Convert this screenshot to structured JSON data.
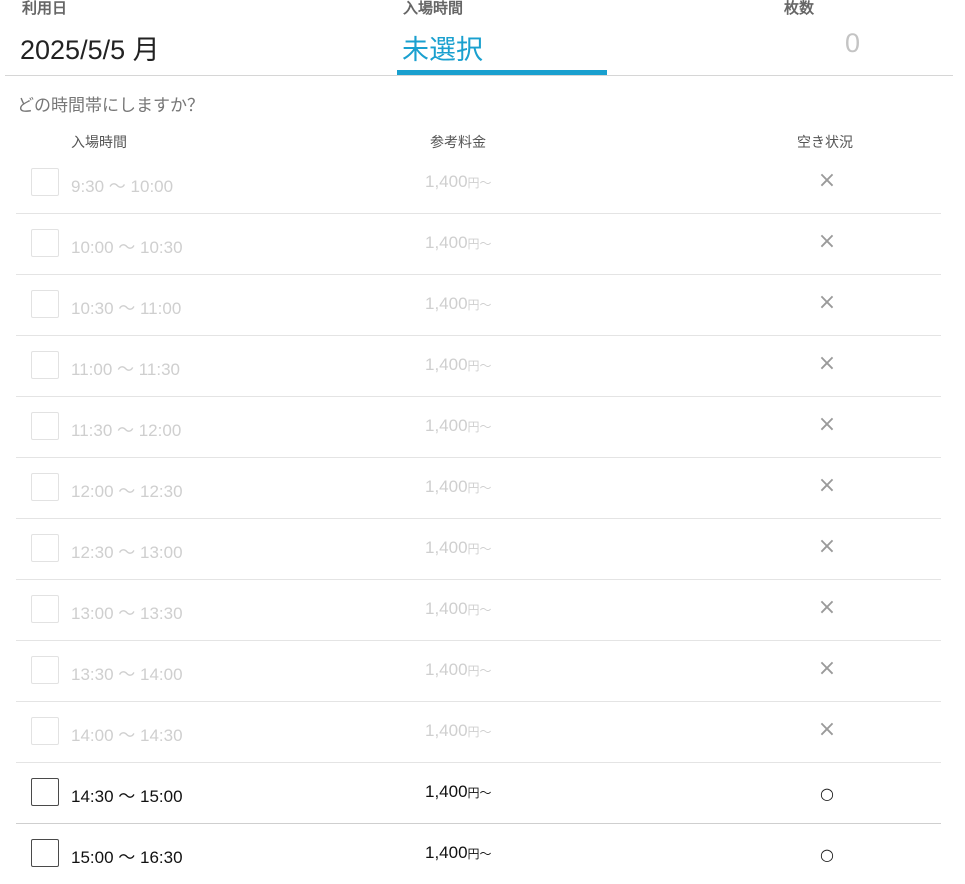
{
  "summary": {
    "date_label": "利用日",
    "date_value": "2025/5/5 月",
    "time_label": "入場時間",
    "time_value": "未選択",
    "count_label": "枚数",
    "count_value": "0"
  },
  "question": "どの時間帯にしますか？",
  "table": {
    "headers": {
      "time": "入場時間",
      "price": "参考料金",
      "status": "空き状況"
    },
    "rows": [
      {
        "time": "9:30 〜 10:00",
        "price": "1,400",
        "unit": "円〜",
        "status": "×",
        "available": false
      },
      {
        "time": "10:00 〜 10:30",
        "price": "1,400",
        "unit": "円〜",
        "status": "×",
        "available": false
      },
      {
        "time": "10:30 〜 11:00",
        "price": "1,400",
        "unit": "円〜",
        "status": "×",
        "available": false
      },
      {
        "time": "11:00 〜 11:30",
        "price": "1,400",
        "unit": "円〜",
        "status": "×",
        "available": false
      },
      {
        "time": "11:30 〜 12:00",
        "price": "1,400",
        "unit": "円〜",
        "status": "×",
        "available": false
      },
      {
        "time": "12:00 〜 12:30",
        "price": "1,400",
        "unit": "円〜",
        "status": "×",
        "available": false
      },
      {
        "time": "12:30 〜 13:00",
        "price": "1,400",
        "unit": "円〜",
        "status": "×",
        "available": false
      },
      {
        "time": "13:00 〜 13:30",
        "price": "1,400",
        "unit": "円〜",
        "status": "×",
        "available": false
      },
      {
        "time": "13:30 〜 14:00",
        "price": "1,400",
        "unit": "円〜",
        "status": "×",
        "available": false
      },
      {
        "time": "14:00 〜 14:30",
        "price": "1,400",
        "unit": "円〜",
        "status": "×",
        "available": false
      },
      {
        "time": "14:30 〜 15:00",
        "price": "1,400",
        "unit": "円〜",
        "status": "○",
        "available": true
      },
      {
        "time": "15:00 〜 16:30",
        "price": "1,400",
        "unit": "円〜",
        "status": "○",
        "available": true
      }
    ]
  },
  "colors": {
    "accent": "#19a0cf",
    "disabled_text": "#cfcfcf",
    "label_text": "#666666"
  },
  "icons": {
    "unavailable": "cross-icon",
    "available": "circle-icon"
  }
}
